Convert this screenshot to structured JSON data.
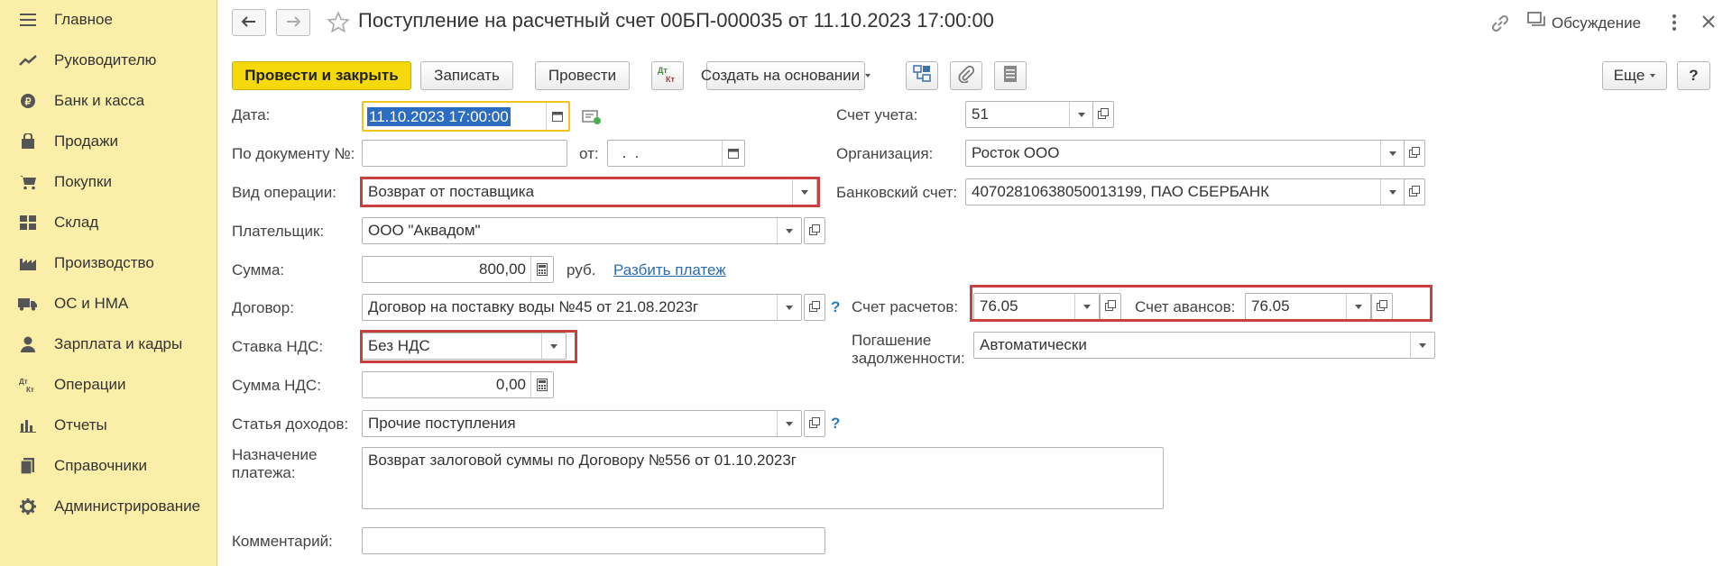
{
  "sidebar": {
    "items": [
      {
        "label": "Главное",
        "icon": "menu-icon"
      },
      {
        "label": "Руководителю",
        "icon": "trend-icon"
      },
      {
        "label": "Банк и касса",
        "icon": "coin-icon"
      },
      {
        "label": "Продажи",
        "icon": "bag-icon"
      },
      {
        "label": "Покупки",
        "icon": "cart-icon"
      },
      {
        "label": "Склад",
        "icon": "warehouse-icon"
      },
      {
        "label": "Производство",
        "icon": "factory-icon"
      },
      {
        "label": "ОС и НМА",
        "icon": "truck-icon"
      },
      {
        "label": "Зарплата и кадры",
        "icon": "person-icon"
      },
      {
        "label": "Операции",
        "icon": "dt-kt-icon"
      },
      {
        "label": "Отчеты",
        "icon": "bar-chart-icon"
      },
      {
        "label": "Справочники",
        "icon": "book-icon"
      },
      {
        "label": "Администрирование",
        "icon": "gear-icon"
      }
    ]
  },
  "header": {
    "title": "Поступление на расчетный счет 00БП-000035 от 11.10.2023 17:00:00",
    "discussion": "Обсуждение"
  },
  "toolbar": {
    "post_close": "Провести и закрыть",
    "save": "Записать",
    "post": "Провести",
    "dtkt_top": "Дт",
    "dtkt_bottom": "Кт",
    "create_based": "Создать на основании",
    "more": "Еще",
    "help": "?"
  },
  "form": {
    "date_label": "Дата:",
    "date_value": "11.10.2023 17:00:00",
    "doc_no_label": "По документу №:",
    "doc_no_value": "",
    "from_label": "от:",
    "from_value": "  .  .",
    "operation_label": "Вид операции:",
    "operation_value": "Возврат от поставщика",
    "payer_label": "Плательщик:",
    "payer_value": "ООО \"Аквадом\"",
    "sum_label": "Сумма:",
    "sum_value": "800,00",
    "currency": "руб.",
    "split_link": "Разбить платеж",
    "contract_label": "Договор:",
    "contract_value": "Договор на поставку воды №45 от 21.08.2023г",
    "vat_rate_label": "Ставка НДС:",
    "vat_rate_value": "Без НДС",
    "vat_sum_label": "Сумма НДС:",
    "vat_sum_value": "0,00",
    "income_label": "Статья доходов:",
    "income_value": "Прочие поступления",
    "purpose_label_1": "Назначение",
    "purpose_label_2": "платежа:",
    "purpose_value": "Возврат залоговой суммы  по Договору №556 от 01.10.2023г",
    "comment_label": "Комментарий:",
    "comment_value": "",
    "account_label": "Счет учета:",
    "account_value": "51",
    "org_label": "Организация:",
    "org_value": "Росток ООО",
    "bank_label": "Банковский счет:",
    "bank_value": "40702810638050013199, ПАО СБЕРБАНК",
    "settle_label": "Счет расчетов:",
    "settle_value": "76.05",
    "advance_label": "Счет авансов:",
    "advance_value": "76.05",
    "repay_label_1": "Погашение",
    "repay_label_2": "задолженности:",
    "repay_value": "Автоматически",
    "help_mark": "?"
  },
  "colors": {
    "sidebar": "#fbeea8",
    "primary": "#f5d90a",
    "highlight": "#c9413f",
    "link": "#2a6db5"
  }
}
